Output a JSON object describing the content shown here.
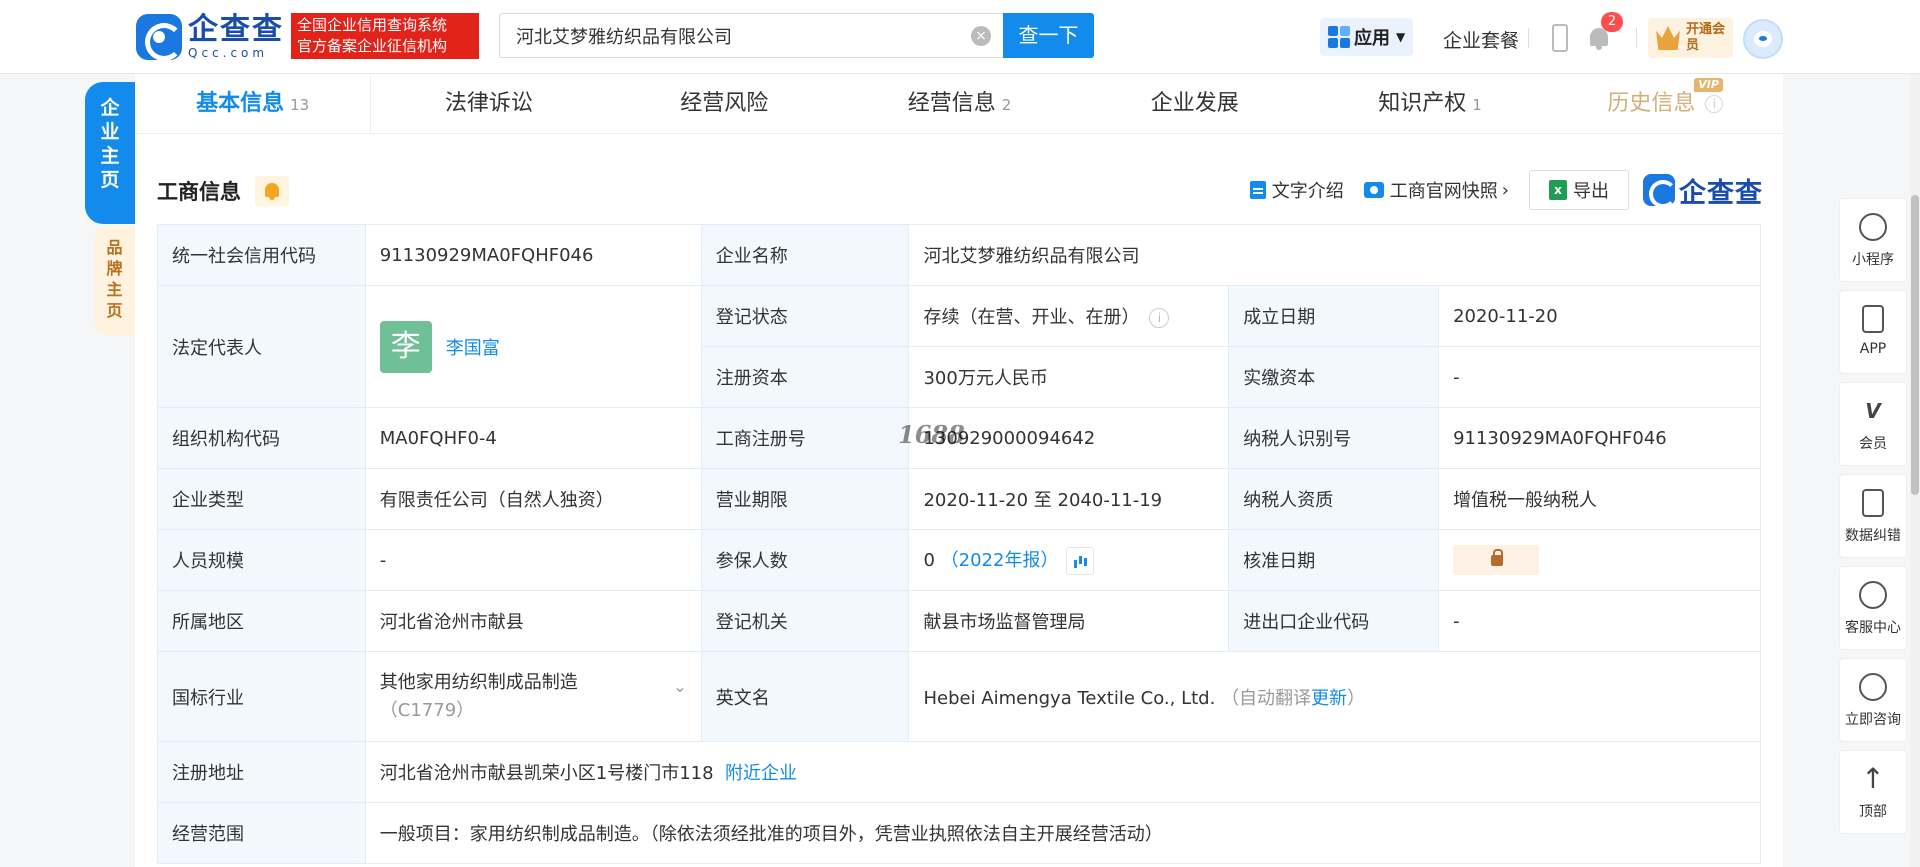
{
  "header": {
    "logo_cn": "企查查",
    "logo_en": "Qcc.com",
    "slogan_line1": "全国企业信用查询系统",
    "slogan_line2": "官方备案企业征信机构",
    "search_value": "河北艾梦雅纺织品有限公司",
    "search_button": "查一下",
    "apps_label": "应用",
    "package_label": "企业套餐",
    "notification_count": "2",
    "vip_open_label": "开通会员"
  },
  "left_tabs": {
    "main": [
      "企",
      "业",
      "主",
      "页"
    ],
    "brand": [
      "品",
      "牌",
      "主",
      "页"
    ]
  },
  "tabs": [
    {
      "label": "基本信息",
      "count": "13"
    },
    {
      "label": "法律诉讼",
      "count": ""
    },
    {
      "label": "经营风险",
      "count": ""
    },
    {
      "label": "经营信息",
      "count": "2"
    },
    {
      "label": "企业发展",
      "count": ""
    },
    {
      "label": "知识产权",
      "count": "1"
    },
    {
      "label": "历史信息",
      "count": "",
      "tag": "VIP"
    }
  ],
  "section": {
    "title": "工商信息",
    "text_intro": "文字介绍",
    "snapshot": "工商官网快照",
    "export": "导出",
    "brand": "企查查"
  },
  "info": {
    "credit_code_label": "统一社会信用代码",
    "credit_code": "91130929MA0FQHF046",
    "name_label": "企业名称",
    "name": "河北艾梦雅纺织品有限公司",
    "legal_label": "法定代表人",
    "legal_avatar": "李",
    "legal_name": "李国富",
    "status_label": "登记状态",
    "status": "存续（在营、开业、在册）",
    "found_label": "成立日期",
    "found": "2020-11-20",
    "capital_label": "注册资本",
    "capital": "300万元人民币",
    "paid_label": "实缴资本",
    "paid": "-",
    "org_label": "组织机构代码",
    "org": "MA0FQHF0-4",
    "reg_no_label": "工商注册号",
    "reg_no": "130929000094642",
    "taxid_label": "纳税人识别号",
    "taxid": "91130929MA0FQHF046",
    "type_label": "企业类型",
    "type": "有限责任公司（自然人独资）",
    "term_label": "营业期限",
    "term": "2020-11-20 至 2040-11-19",
    "taxq_label": "纳税人资质",
    "taxq": "增值税一般纳税人",
    "staff_label": "人员规模",
    "staff": "-",
    "insured_label": "参保人数",
    "insured": "0",
    "insured_year": "（2022年报）",
    "approve_label": "核准日期",
    "region_label": "所属地区",
    "region": "河北省沧州市献县",
    "authority_label": "登记机关",
    "authority": "献县市场监督管理局",
    "ie_label": "进出口企业代码",
    "ie": "-",
    "industry_label": "国标行业",
    "industry": "其他家用纺织制成品制造",
    "industry_code": "（C1779）",
    "en_label": "英文名",
    "en_name": "Hebei Aimengya Textile Co., Ltd.",
    "en_auto": "（自动翻译",
    "en_update": "更新",
    "en_close": "）",
    "address_label": "注册地址",
    "address": "河北省沧州市献县凯荣小区1号楼门市118",
    "nearby": "附近企业",
    "scope_label": "经营范围",
    "scope": "一般项目：家用纺织制成品制造。（除依法须经批准的项目外，凭营业执照依法自主开展经营活动）"
  },
  "watermark": "1688",
  "right_bar": [
    "小程序",
    "APP",
    "会员",
    "数据纠错",
    "客服中心",
    "立即咨询",
    "顶部"
  ]
}
